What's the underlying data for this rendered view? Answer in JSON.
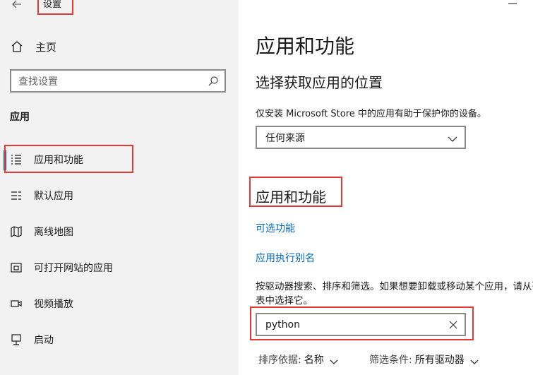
{
  "window": {
    "title": "设置"
  },
  "sidebar": {
    "home_label": "主页",
    "search_placeholder": "查找设置",
    "section_label": "应用",
    "items": [
      {
        "label": "应用和功能",
        "icon": "apps-features-icon",
        "active": true
      },
      {
        "label": "默认应用",
        "icon": "default-apps-icon"
      },
      {
        "label": "离线地图",
        "icon": "offline-maps-icon"
      },
      {
        "label": "可打开网站的应用",
        "icon": "apps-for-websites-icon"
      },
      {
        "label": "视频播放",
        "icon": "video-playback-icon"
      },
      {
        "label": "启动",
        "icon": "startup-icon"
      }
    ]
  },
  "main": {
    "title": "应用和功能",
    "source_heading": "选择获取应用的位置",
    "source_desc": "仅安装 Microsoft Store 中的应用有助于保护你的设备。",
    "source_value": "任何来源",
    "apps_heading": "应用和功能",
    "links": [
      "可选功能",
      "应用执行别名"
    ],
    "search_desc": "按驱动器搜索、排序和筛选。如果想要卸载或移动某个应用，请从列表中选择它。",
    "search_value": "python",
    "sort_label": "排序依据:",
    "sort_value": "名称",
    "filter_label": "筛选条件:",
    "filter_value": "所有驱动器"
  },
  "colors": {
    "accent": "#0067c0",
    "annotation": "#e53935"
  }
}
